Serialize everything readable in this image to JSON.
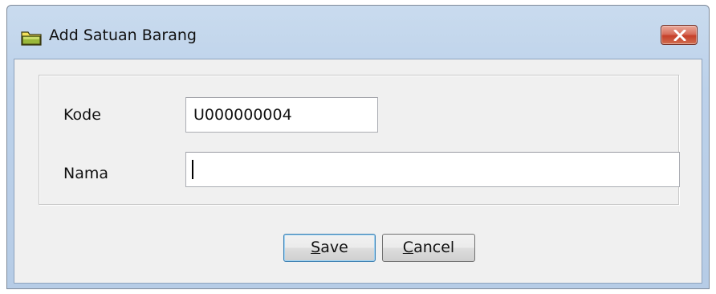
{
  "window": {
    "title": "Add Satuan Barang"
  },
  "icons": {
    "title_icon": "folder-icon",
    "close_icon": "close-icon"
  },
  "colors": {
    "close_button": "#c6402a",
    "titlebar": "#bcd1ea",
    "client_background": "#f0f0f0"
  },
  "form": {
    "kode_label": "Kode",
    "kode_value": "U000000004",
    "nama_label": "Nama",
    "nama_value": ""
  },
  "buttons": {
    "save_mnemonic": "S",
    "save_rest": "ave",
    "cancel_mnemonic": "C",
    "cancel_rest": "ancel"
  }
}
